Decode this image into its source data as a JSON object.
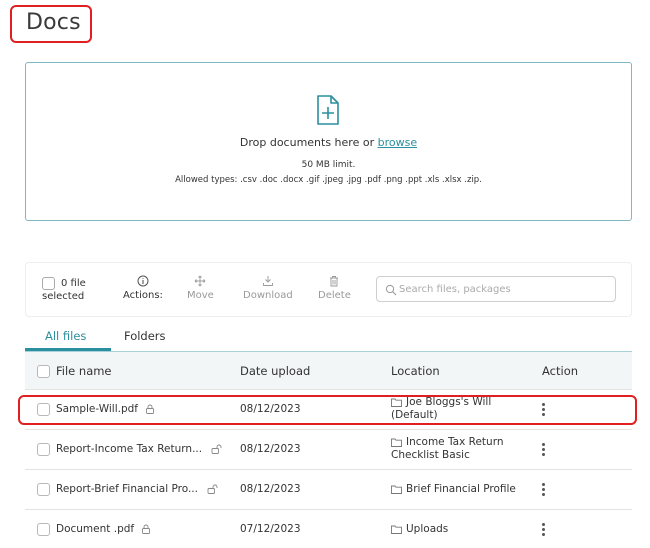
{
  "page": {
    "title": "Docs"
  },
  "dropzone": {
    "prompt_before": "Drop documents here or ",
    "browse_link": "browse",
    "limit": "50 MB limit.",
    "allowed_types": "Allowed types: .csv .doc .docx .gif .jpeg .jpg .pdf .png .ppt .xls .xlsx .zip."
  },
  "toolbar": {
    "selected_count": "0 file",
    "selected_label": "selected",
    "actions_label": "Actions:",
    "move_label": "Move",
    "download_label": "Download",
    "delete_label": "Delete",
    "search_placeholder": "Search files, packages"
  },
  "tabs": [
    {
      "label": "All files",
      "active": true
    },
    {
      "label": "Folders",
      "active": false
    }
  ],
  "table": {
    "headers": {
      "name": "File name",
      "date": "Date upload",
      "location": "Location",
      "action": "Action"
    },
    "rows": [
      {
        "name": "Sample-Will.pdf",
        "lock": "locked",
        "date": "08/12/2023",
        "location_line1": "Joe Bloggs's Will",
        "location_line2": "(Default)",
        "highlighted": true
      },
      {
        "name": "Report-Income Tax Return...",
        "lock": "unlocked",
        "date": "08/12/2023",
        "location_line1": "Income Tax Return",
        "location_line2": "Checklist Basic"
      },
      {
        "name": "Report-Brief Financial Pro...",
        "lock": "unlocked",
        "date": "08/12/2023",
        "location_line1": "Brief Financial Profile",
        "location_line2": ""
      },
      {
        "name": "Document .pdf",
        "lock": "locked",
        "date": "07/12/2023",
        "location_line1": "Uploads",
        "location_line2": ""
      }
    ]
  },
  "colors": {
    "accent": "#2a8f9f",
    "highlight": "#e02020",
    "header_bg": "#f3f6f6"
  },
  "icons": [
    "file-plus-icon",
    "info-icon",
    "move-icon",
    "download-icon",
    "trash-icon",
    "search-icon",
    "lock-icon",
    "unlock-icon",
    "folder-icon",
    "kebab-menu-icon"
  ]
}
